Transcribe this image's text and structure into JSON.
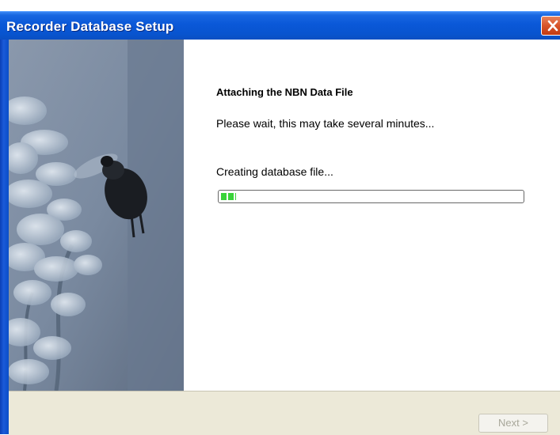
{
  "window": {
    "title": "Recorder Database Setup"
  },
  "content": {
    "heading": "Attaching the NBN Data File",
    "wait_message": "Please wait, this may take several minutes...",
    "status": "Creating database file..."
  },
  "progress": {
    "fraction": 0.05,
    "color": "#39d339"
  },
  "footer": {
    "next_label": "Next >"
  },
  "colors": {
    "titlebar": "#0a58d8",
    "close_button": "#d8542a",
    "footer_bg": "#ece9d8"
  },
  "icons": {
    "close": "close-x-icon",
    "side_image": "bumblebee-on-flowers-image"
  }
}
